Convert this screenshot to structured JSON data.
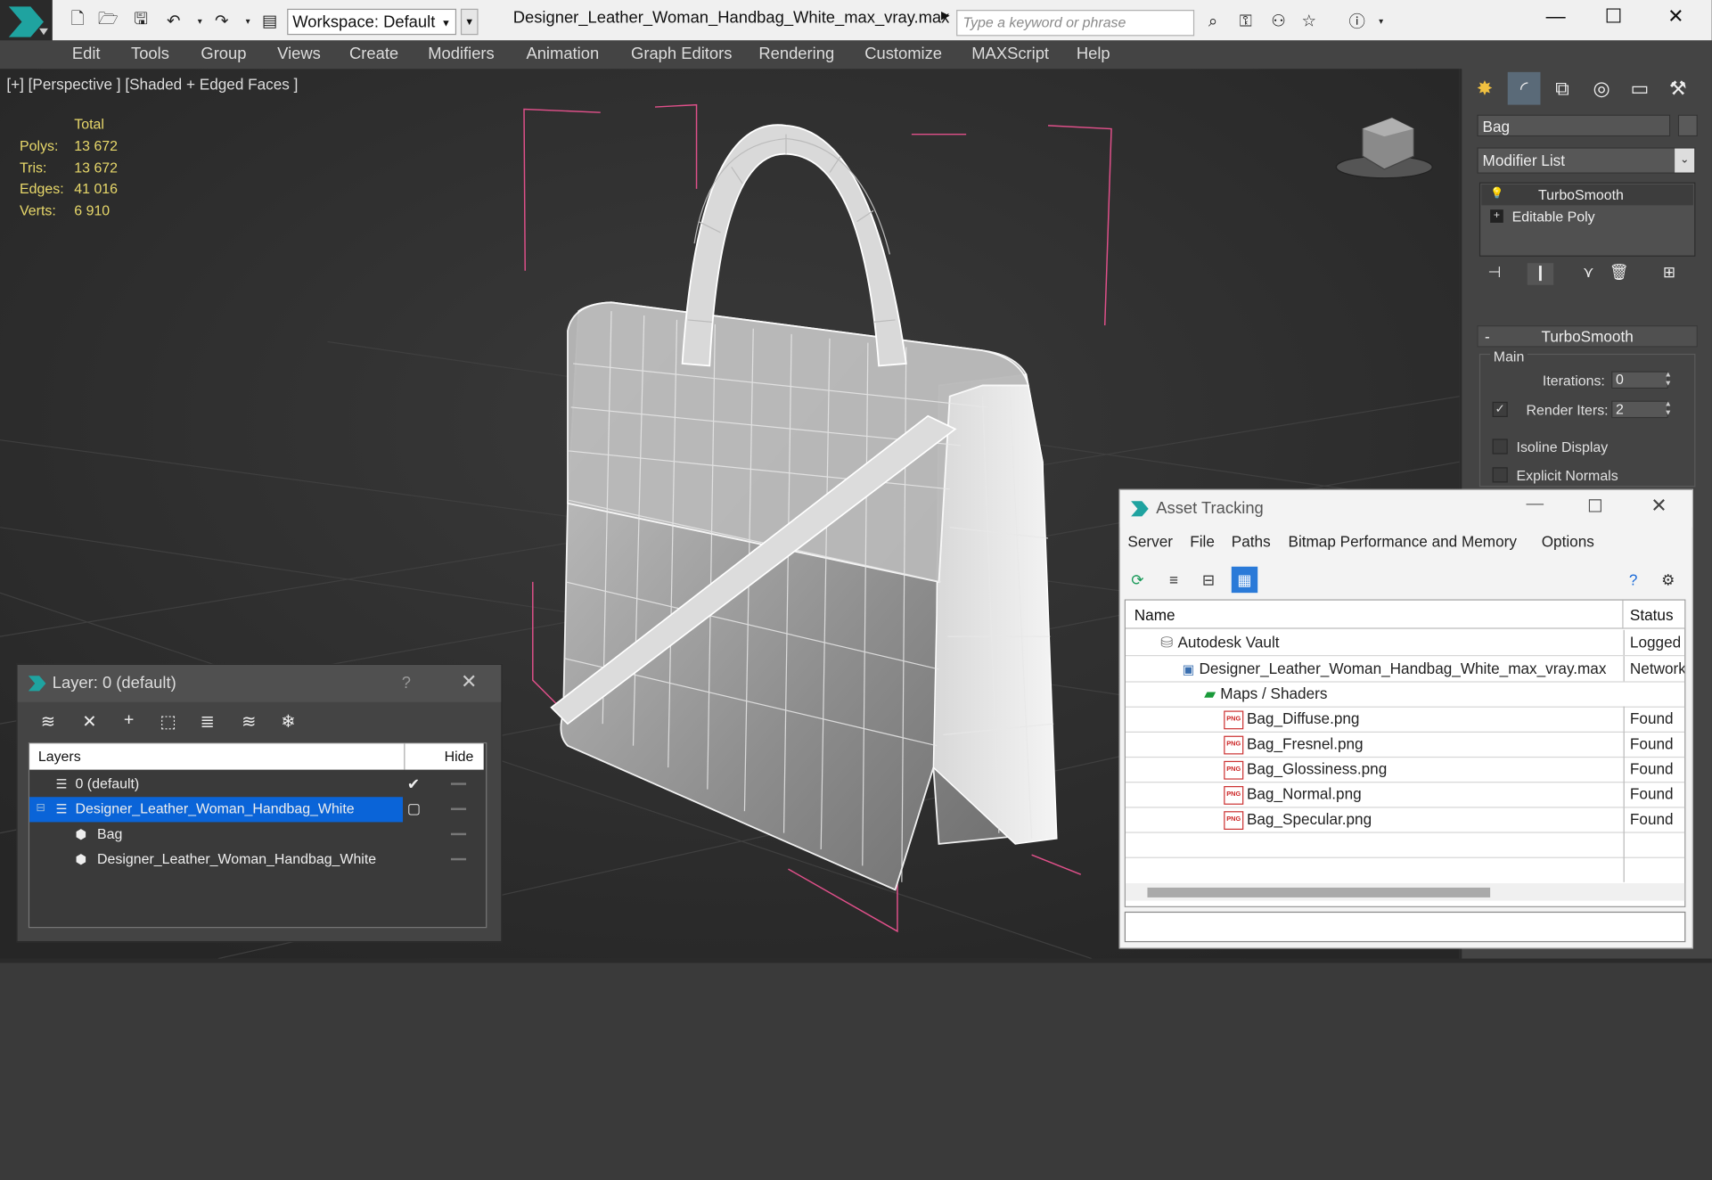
{
  "window": {
    "title": "Designer_Leather_Woman_Handbag_White_max_vray.max",
    "workspace": "Workspace: Default",
    "search_placeholder": "Type a keyword or phrase"
  },
  "menu": [
    "Edit",
    "Tools",
    "Group",
    "Views",
    "Create",
    "Modifiers",
    "Animation",
    "Graph Editors",
    "Rendering",
    "Customize",
    "MAXScript",
    "Help"
  ],
  "viewport": {
    "label": "[+] [Perspective ] [Shaded + Edged Faces ]",
    "stats": {
      "header": "Total",
      "rows": [
        {
          "label": "Polys:",
          "value": "13 672"
        },
        {
          "label": "Tris:",
          "value": "13 672"
        },
        {
          "label": "Edges:",
          "value": "41 016"
        },
        {
          "label": "Verts:",
          "value": "6 910"
        }
      ]
    }
  },
  "command_panel": {
    "object_name": "Bag",
    "modifier_list": "Modifier List",
    "stack": [
      "TurboSmooth",
      "Editable Poly"
    ],
    "rollout_title": "TurboSmooth",
    "group_main": "Main",
    "iterations_label": "Iterations:",
    "iterations_value": "0",
    "render_iters_label": "Render Iters:",
    "render_iters_value": "2",
    "render_iters_checked": true,
    "isoline_label": "Isoline Display",
    "explicit_normals_label": "Explicit Normals"
  },
  "layer_dialog": {
    "title": "Layer: 0 (default)",
    "help": "?",
    "col_layers": "Layers",
    "col_hide": "Hide",
    "rows": [
      {
        "name": "0 (default)",
        "indent": 0
      },
      {
        "name": "Designer_Leather_Woman_Handbag_White",
        "indent": 0,
        "selected": true
      },
      {
        "name": "Bag",
        "indent": 1
      },
      {
        "name": "Designer_Leather_Woman_Handbag_White",
        "indent": 1
      }
    ]
  },
  "asset_dialog": {
    "title": "Asset Tracking",
    "menu": [
      "Server",
      "File",
      "Paths",
      "Bitmap Performance and Memory",
      "Options"
    ],
    "col_name": "Name",
    "col_status": "Status",
    "rows": [
      {
        "name": "Autodesk Vault",
        "status": "Logged Out",
        "icon": "vault-icon"
      },
      {
        "name": "Designer_Leather_Woman_Handbag_White_max_vray.max",
        "status": "Network",
        "icon": "max-file-icon"
      },
      {
        "name": "Maps / Shaders",
        "status": "",
        "icon": "maps-folder-icon"
      },
      {
        "name": "Bag_Diffuse.png",
        "status": "Found",
        "icon": "png-icon"
      },
      {
        "name": "Bag_Fresnel.png",
        "status": "Found",
        "icon": "png-icon"
      },
      {
        "name": "Bag_Glossiness.png",
        "status": "Found",
        "icon": "png-icon"
      },
      {
        "name": "Bag_Normal.png",
        "status": "Found",
        "icon": "png-icon"
      },
      {
        "name": "Bag_Specular.png",
        "status": "Found",
        "icon": "png-icon"
      }
    ]
  },
  "colors": {
    "accent": "#0a64d8",
    "stats_yellow": "#e8d86a",
    "selection_pink": "#e0508a"
  }
}
